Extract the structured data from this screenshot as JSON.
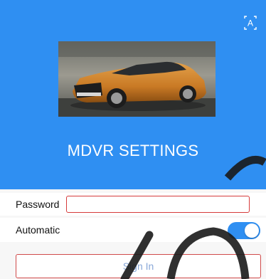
{
  "header": {
    "background_color": "#2f8ff2",
    "language_icon": "language-a-icon",
    "car_image": "photo of an orange SUV",
    "title": "MDVR SETTINGS"
  },
  "form": {
    "password_label": "Password",
    "password_value": "",
    "automatic_label": "Automatic",
    "automatic_enabled": true,
    "signin_label": "Sign In"
  },
  "colors": {
    "accent": "#2f8ff2",
    "error_border": "#d63b3b",
    "signin_text": "#8aa8d8"
  }
}
